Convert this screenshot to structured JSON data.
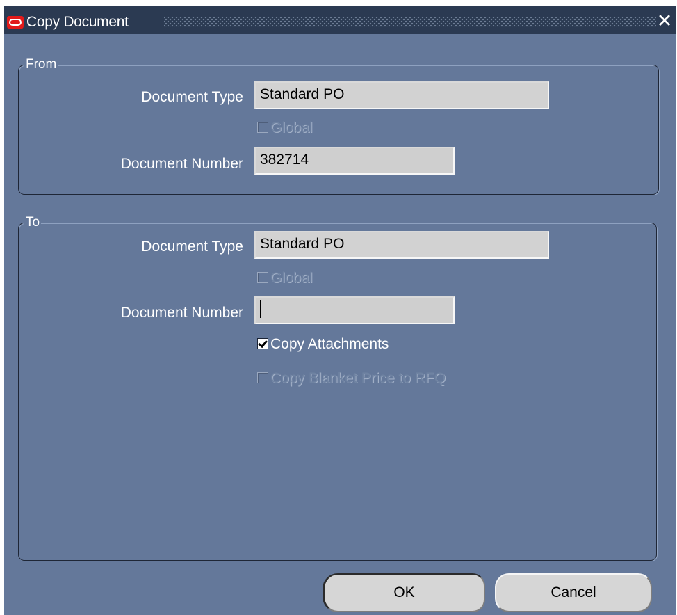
{
  "window": {
    "title": "Copy Document",
    "close_glyph": "✕"
  },
  "from": {
    "group_label": "From",
    "document_type_label": "Document Type",
    "document_type_value": "Standard PO",
    "global_label": "Global",
    "global_checked": false,
    "document_number_label": "Document Number",
    "document_number_value": "382714"
  },
  "to": {
    "group_label": "To",
    "document_type_label": "Document Type",
    "document_type_value": "Standard PO",
    "global_label": "Global",
    "global_checked": false,
    "document_number_label": "Document Number",
    "document_number_value": "",
    "copy_attachments_label": "Copy Attachments",
    "copy_attachments_checked": true,
    "copy_blanket_label": "Copy Blanket Price to RFQ",
    "copy_blanket_checked": false
  },
  "buttons": {
    "ok_label": "OK",
    "cancel_label": "Cancel"
  },
  "icons": {
    "app_logo": "oracle-logo-icon",
    "close": "close-icon",
    "checkbox_checked": "check-icon"
  },
  "colors": {
    "window_bg": "#64789a",
    "titlebar_bg": "#2b3a52",
    "field_bg": "#cfcfcf",
    "logo_red": "#e21a1a"
  }
}
